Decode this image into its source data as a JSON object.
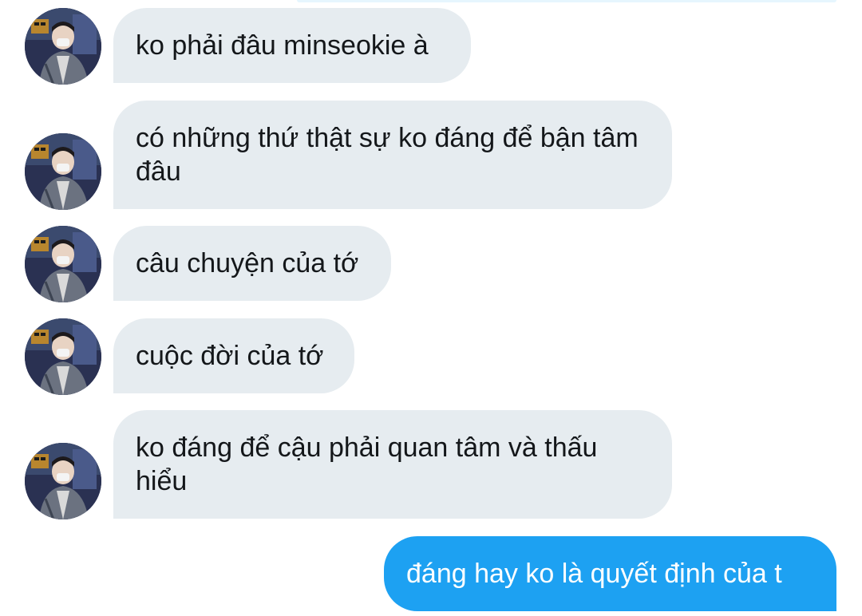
{
  "conversation": {
    "messages": [
      {
        "text": "ko phải đâu minseokie à",
        "direction": "received"
      },
      {
        "text": "có những thứ thật sự ko đáng để bận tâm đâu",
        "direction": "received"
      },
      {
        "text": "câu chuyện của tớ",
        "direction": "received"
      },
      {
        "text": "cuộc đời của tớ",
        "direction": "received"
      },
      {
        "text": "ko đáng để cậu phải quan tâm và thấu hiểu",
        "direction": "received"
      },
      {
        "text": "đáng hay ko là quyết định của t",
        "direction": "sent"
      }
    ]
  },
  "colors": {
    "received_bubble": "#e6ecf0",
    "sent_bubble": "#1da1f2",
    "text_dark": "#14171a",
    "text_light": "#ffffff"
  }
}
